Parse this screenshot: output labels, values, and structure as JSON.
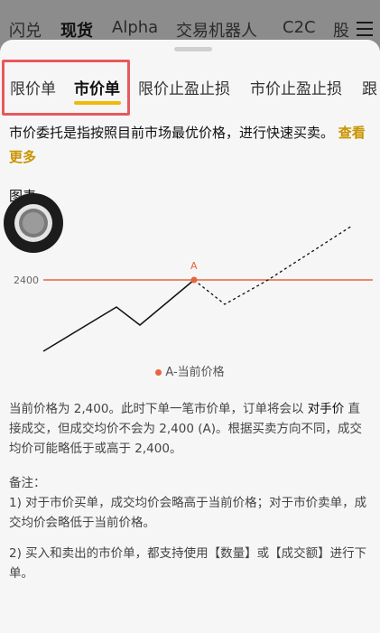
{
  "top_nav": {
    "items": [
      "闪兑",
      "现货",
      "Alpha",
      "交易机器人",
      "C2C",
      "股"
    ],
    "active_index": 1
  },
  "tabs": {
    "items": [
      "限价单",
      "市价单",
      "限价止盈止损",
      "市价止盈止损",
      "跟"
    ],
    "active_index": 1
  },
  "description": {
    "text": "市价委托是指按照目前市场最优价格，进行快速买卖。",
    "link": "查看更多"
  },
  "chart_section_title": "图表",
  "chart_data": {
    "type": "line",
    "y_label_value": "2400",
    "marker_label": "A",
    "legend": "A-当前价格",
    "reference_level": 2400,
    "colors": {
      "reference": "#e8643c",
      "line": "#111111"
    }
  },
  "paragraphs": {
    "p1_a": "当前价格为 2,400。此时下单一笔市价单，订单将会以 ",
    "p1_bold": "对手价",
    "p1_b": " 直接成交，但成交均价不会为 2,400 (A)。根据买卖方向不同，成交均价可能略低于或高于 2,400。",
    "note_title": "备注：",
    "note1": "1) 对于市价买单，成交均价会略高于当前价格；对于市价卖单，成交均价会略低于当前价格。",
    "note2": "2) 买入和卖出的市价单，都支持使用【数量】或【成交额】进行下单。"
  },
  "icons": {
    "menu": "hamburger-menu-icon",
    "fab": "floating-assistant-icon"
  }
}
